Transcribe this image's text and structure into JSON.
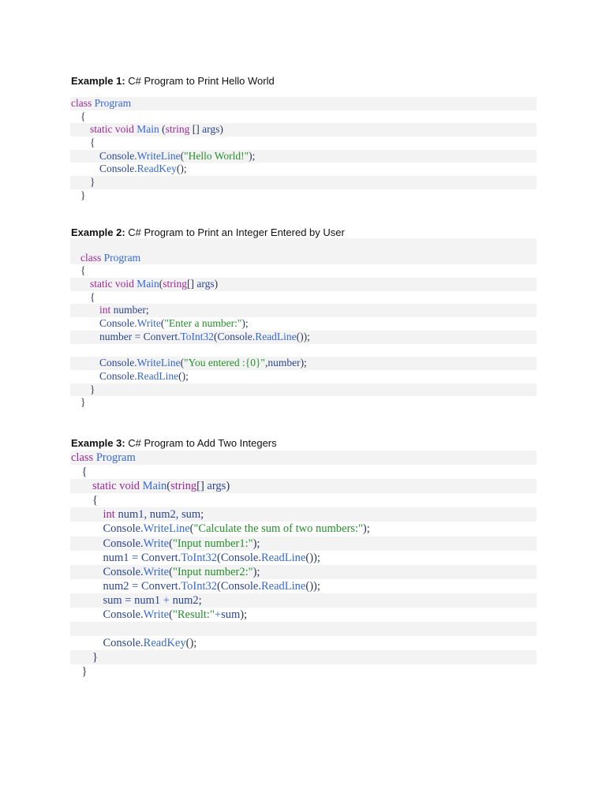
{
  "examples": [
    {
      "label": "Example 1:",
      "title": " C# Program to Print Hello World",
      "lines": [
        {
          "indent": 0,
          "shade": true,
          "tokens": [
            [
              "class ",
              "k"
            ],
            [
              "Program",
              "t"
            ]
          ]
        },
        {
          "indent": 1,
          "shade": false,
          "tokens": [
            [
              "{",
              "p"
            ]
          ]
        },
        {
          "indent": 2,
          "shade": true,
          "tokens": [
            [
              "static void ",
              "k"
            ],
            [
              "Main ",
              "t"
            ],
            [
              "(",
              "p"
            ],
            [
              "string ",
              "k"
            ],
            [
              "[] ",
              "p"
            ],
            [
              "args",
              "i"
            ],
            [
              ")",
              "p"
            ]
          ]
        },
        {
          "indent": 2,
          "shade": false,
          "tokens": [
            [
              "{",
              "p"
            ]
          ]
        },
        {
          "indent": 3,
          "shade": true,
          "tokens": [
            [
              "Console.",
              "i"
            ],
            [
              "WriteLine",
              "t"
            ],
            [
              "(",
              "p"
            ],
            [
              "\"Hello World!\"",
              "s"
            ],
            [
              ");",
              "p"
            ]
          ]
        },
        {
          "indent": 3,
          "shade": false,
          "tokens": [
            [
              "Console.",
              "i"
            ],
            [
              "ReadKey",
              "t"
            ],
            [
              "();",
              "p"
            ]
          ]
        },
        {
          "indent": 2,
          "shade": true,
          "tokens": [
            [
              "}",
              "p"
            ]
          ]
        },
        {
          "indent": 1,
          "shade": false,
          "tokens": [
            [
              "}",
              "p"
            ]
          ]
        }
      ]
    },
    {
      "label": "Example 2:",
      "title": " C# Program to Print an Integer Entered by User",
      "lines": [
        {
          "indent": 0,
          "shade": true,
          "tokens": []
        },
        {
          "indent": 1,
          "shade": true,
          "tokens": [
            [
              "class ",
              "k"
            ],
            [
              "Program",
              "t"
            ]
          ]
        },
        {
          "indent": 1,
          "shade": false,
          "tokens": [
            [
              "{",
              "p"
            ]
          ]
        },
        {
          "indent": 2,
          "shade": true,
          "tokens": [
            [
              "static void ",
              "k"
            ],
            [
              "Main",
              "t"
            ],
            [
              "(",
              "p"
            ],
            [
              "string",
              "k"
            ],
            [
              "[] ",
              "p"
            ],
            [
              "args",
              "i"
            ],
            [
              ")",
              "p"
            ]
          ]
        },
        {
          "indent": 2,
          "shade": false,
          "tokens": [
            [
              "{",
              "p"
            ]
          ]
        },
        {
          "indent": 3,
          "shade": true,
          "tokens": [
            [
              "int ",
              "k"
            ],
            [
              "number",
              "i"
            ],
            [
              ";",
              "p"
            ]
          ]
        },
        {
          "indent": 3,
          "shade": false,
          "tokens": [
            [
              "Console.",
              "i"
            ],
            [
              "Write",
              "t"
            ],
            [
              "(",
              "p"
            ],
            [
              "\"Enter a number:\"",
              "s"
            ],
            [
              ");",
              "p"
            ]
          ]
        },
        {
          "indent": 3,
          "shade": true,
          "tokens": [
            [
              "number = Convert.",
              "i"
            ],
            [
              "ToInt32",
              "t"
            ],
            [
              "(",
              "p"
            ],
            [
              "Console.",
              "i"
            ],
            [
              "ReadLine",
              "t"
            ],
            [
              "());",
              "p"
            ]
          ]
        },
        {
          "indent": 0,
          "shade": false,
          "tokens": []
        },
        {
          "indent": 3,
          "shade": true,
          "tokens": [
            [
              "Console.",
              "i"
            ],
            [
              "WriteLine",
              "t"
            ],
            [
              "(",
              "p"
            ],
            [
              "\"You entered :{0}\"",
              "s"
            ],
            [
              ",",
              "p"
            ],
            [
              "number",
              "i"
            ],
            [
              ");",
              "p"
            ]
          ]
        },
        {
          "indent": 3,
          "shade": false,
          "tokens": [
            [
              "Console.",
              "i"
            ],
            [
              "ReadLine",
              "t"
            ],
            [
              "();",
              "p"
            ]
          ]
        },
        {
          "indent": 2,
          "shade": true,
          "tokens": [
            [
              "}",
              "p"
            ]
          ]
        },
        {
          "indent": 1,
          "shade": false,
          "tokens": [
            [
              "}",
              "p"
            ]
          ]
        }
      ]
    },
    {
      "label": "Example 3:",
      "title": " C# Program to Add Two Integers",
      "lines": [
        {
          "indent": 0,
          "shade": true,
          "tokens": [
            [
              "class ",
              "k"
            ],
            [
              "Program",
              "t"
            ]
          ]
        },
        {
          "indent": 1,
          "shade": false,
          "tokens": [
            [
              "{",
              "p"
            ]
          ]
        },
        {
          "indent": 2,
          "shade": true,
          "tokens": [
            [
              "static void ",
              "k"
            ],
            [
              "Main",
              "t"
            ],
            [
              "(",
              "p"
            ],
            [
              "string",
              "k"
            ],
            [
              "[] ",
              "p"
            ],
            [
              "args",
              "i"
            ],
            [
              ")",
              "p"
            ]
          ]
        },
        {
          "indent": 2,
          "shade": false,
          "tokens": [
            [
              "{",
              "p"
            ]
          ]
        },
        {
          "indent": 3,
          "shade": true,
          "tokens": [
            [
              "int ",
              "k"
            ],
            [
              "num1, num2, sum",
              "i"
            ],
            [
              ";",
              "p"
            ]
          ]
        },
        {
          "indent": 3,
          "shade": false,
          "tokens": [
            [
              "Console.",
              "i"
            ],
            [
              "WriteLine",
              "t"
            ],
            [
              "(",
              "p"
            ],
            [
              "\"Calculate the sum of two numbers:\"",
              "s"
            ],
            [
              ");",
              "p"
            ]
          ]
        },
        {
          "indent": 3,
          "shade": true,
          "tokens": [
            [
              "Console.",
              "i"
            ],
            [
              "Write",
              "t"
            ],
            [
              "(",
              "p"
            ],
            [
              "\"Input number1:\"",
              "s"
            ],
            [
              ");",
              "p"
            ]
          ]
        },
        {
          "indent": 3,
          "shade": false,
          "tokens": [
            [
              "num1 = Convert.",
              "i"
            ],
            [
              "ToInt32",
              "t"
            ],
            [
              "(",
              "p"
            ],
            [
              "Console.",
              "i"
            ],
            [
              "ReadLine",
              "t"
            ],
            [
              "());",
              "p"
            ]
          ]
        },
        {
          "indent": 3,
          "shade": true,
          "tokens": [
            [
              "Console.",
              "i"
            ],
            [
              "Write",
              "t"
            ],
            [
              "(",
              "p"
            ],
            [
              "\"Input number2:\"",
              "s"
            ],
            [
              ");",
              "p"
            ]
          ]
        },
        {
          "indent": 3,
          "shade": false,
          "tokens": [
            [
              "num2 = Convert.",
              "i"
            ],
            [
              "ToInt32",
              "t"
            ],
            [
              "(",
              "p"
            ],
            [
              "Console.",
              "i"
            ],
            [
              "ReadLine",
              "t"
            ],
            [
              "());",
              "p"
            ]
          ]
        },
        {
          "indent": 3,
          "shade": true,
          "tokens": [
            [
              "sum = num1 ",
              "i"
            ],
            [
              "+ ",
              "t"
            ],
            [
              "num2",
              "i"
            ],
            [
              ";",
              "p"
            ]
          ]
        },
        {
          "indent": 3,
          "shade": false,
          "tokens": [
            [
              "Console.",
              "i"
            ],
            [
              "Write",
              "t"
            ],
            [
              "(",
              "p"
            ],
            [
              "\"Result:\"",
              "s"
            ],
            [
              "+",
              "t"
            ],
            [
              "sum",
              "i"
            ],
            [
              ");",
              "p"
            ]
          ]
        },
        {
          "indent": 0,
          "shade": true,
          "tokens": []
        },
        {
          "indent": 3,
          "shade": false,
          "tokens": [
            [
              "Console.",
              "i"
            ],
            [
              "ReadKey",
              "t"
            ],
            [
              "();",
              "p"
            ]
          ]
        },
        {
          "indent": 2,
          "shade": true,
          "tokens": [
            [
              "}",
              "p"
            ]
          ]
        },
        {
          "indent": 1,
          "shade": false,
          "tokens": [
            [
              "}",
              "p"
            ]
          ]
        }
      ]
    }
  ]
}
